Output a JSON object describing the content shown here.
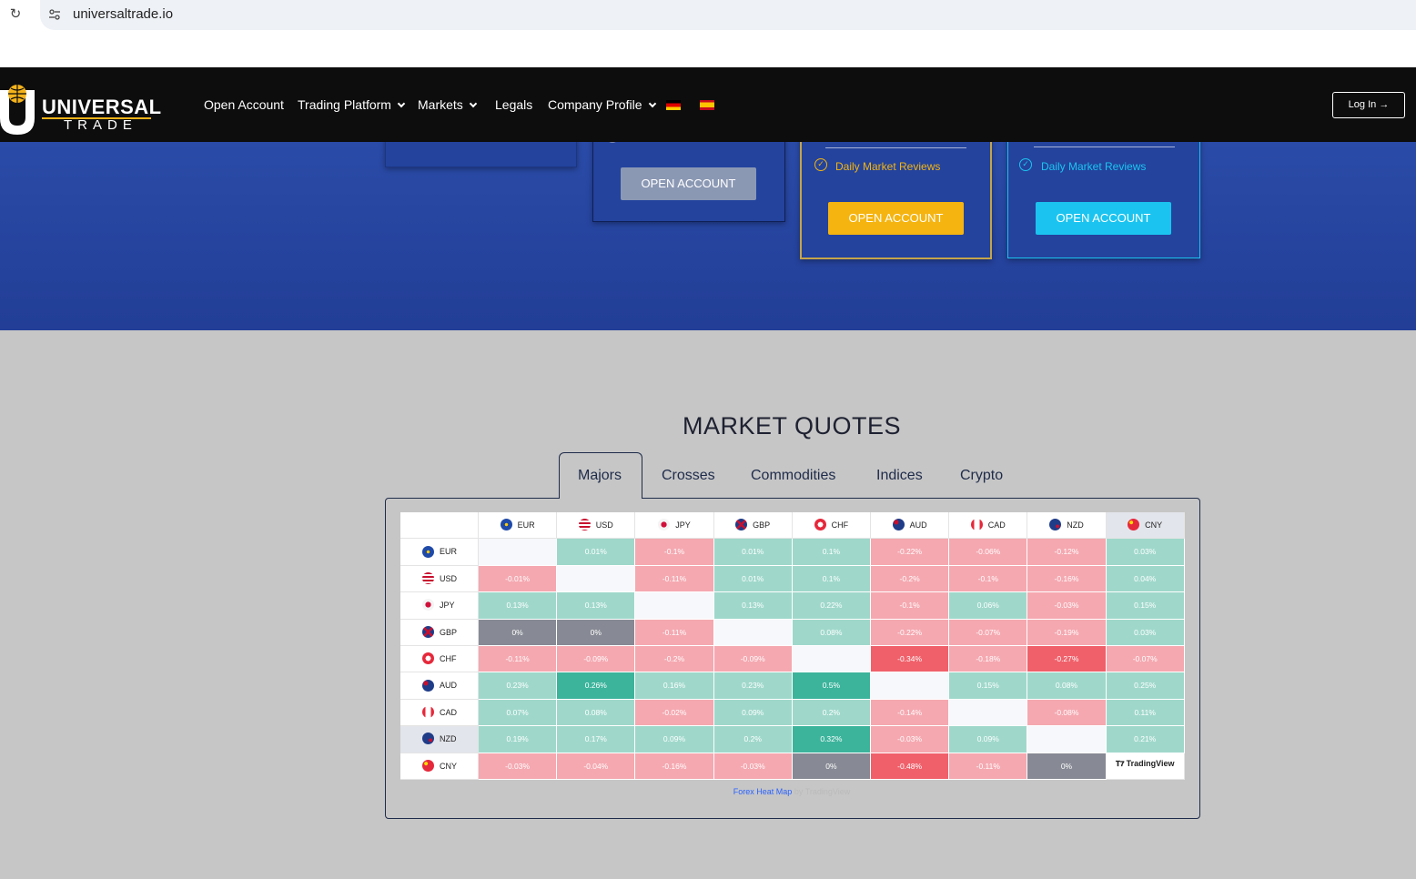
{
  "browser": {
    "url": "universaltrade.io"
  },
  "header": {
    "logo": {
      "line1": "UNIVERSAL",
      "line2": "TRADE"
    },
    "nav": [
      {
        "label": "Open Account",
        "dropdown": false
      },
      {
        "label": "Trading Platform",
        "dropdown": true
      },
      {
        "label": "Markets",
        "dropdown": true
      },
      {
        "label": "Legals",
        "dropdown": false
      },
      {
        "label": "Company Profile",
        "dropdown": true
      }
    ],
    "languages": [
      "german-flag-icon",
      "spanish-flag-icon"
    ],
    "login_label": "Log In"
  },
  "hero": {
    "cards": [
      {
        "variant": "partial"
      },
      {
        "cta": "OPEN ACCOUNT",
        "cta_color": "#8b98b4"
      },
      {
        "feature": "Daily Market Reviews",
        "cta": "OPEN ACCOUNT",
        "accent": "#f5b40f"
      },
      {
        "feature": "Daily Market Reviews",
        "cta": "OPEN ACCOUNT",
        "accent": "#1bc4f0"
      }
    ]
  },
  "market_quotes": {
    "title": "MARKET QUOTES",
    "tabs": [
      "Majors",
      "Crosses",
      "Commodities",
      "Indices",
      "Crypto"
    ],
    "active_tab": "Majors",
    "heatmap": {
      "currencies": [
        "EUR",
        "USD",
        "JPY",
        "GBP",
        "CHF",
        "AUD",
        "CAD",
        "NZD",
        "CNY"
      ],
      "rows": [
        [
          "",
          "0.01%",
          "-0.1%",
          "0.01%",
          "0.1%",
          "-0.22%",
          "-0.06%",
          "-0.12%",
          "0.03%"
        ],
        [
          "-0.01%",
          "",
          "-0.11%",
          "0.01%",
          "0.1%",
          "-0.2%",
          "-0.1%",
          "-0.16%",
          "0.04%"
        ],
        [
          "0.13%",
          "0.13%",
          "",
          "0.13%",
          "0.22%",
          "-0.1%",
          "0.06%",
          "-0.03%",
          "0.15%"
        ],
        [
          "0%",
          "0%",
          "-0.11%",
          "",
          "0.08%",
          "-0.22%",
          "-0.07%",
          "-0.19%",
          "0.03%"
        ],
        [
          "-0.11%",
          "-0.09%",
          "-0.2%",
          "-0.09%",
          "",
          "-0.34%",
          "-0.18%",
          "-0.27%",
          "-0.07%"
        ],
        [
          "0.23%",
          "0.26%",
          "0.16%",
          "0.23%",
          "0.5%",
          "",
          "0.15%",
          "0.08%",
          "0.25%"
        ],
        [
          "0.07%",
          "0.08%",
          "-0.02%",
          "0.09%",
          "0.2%",
          "-0.14%",
          "",
          "-0.08%",
          "0.11%"
        ],
        [
          "0.19%",
          "0.17%",
          "0.09%",
          "0.2%",
          "0.32%",
          "-0.03%",
          "0.09%",
          "",
          "0.21%"
        ],
        [
          "-0.03%",
          "-0.04%",
          "-0.16%",
          "-0.03%",
          "0%",
          "-0.48%",
          "-0.11%",
          "0%",
          ""
        ]
      ],
      "badge": "TradingView",
      "footer_link": "Forex Heat Map",
      "footer_by": "by TradingView"
    },
    "colors": {
      "positive": "#9fd8cb",
      "positive_strong": "#3cb49c",
      "negative": "#f5a8b0",
      "negative_strong": "#f0606a",
      "neutral": "#878a94"
    }
  }
}
